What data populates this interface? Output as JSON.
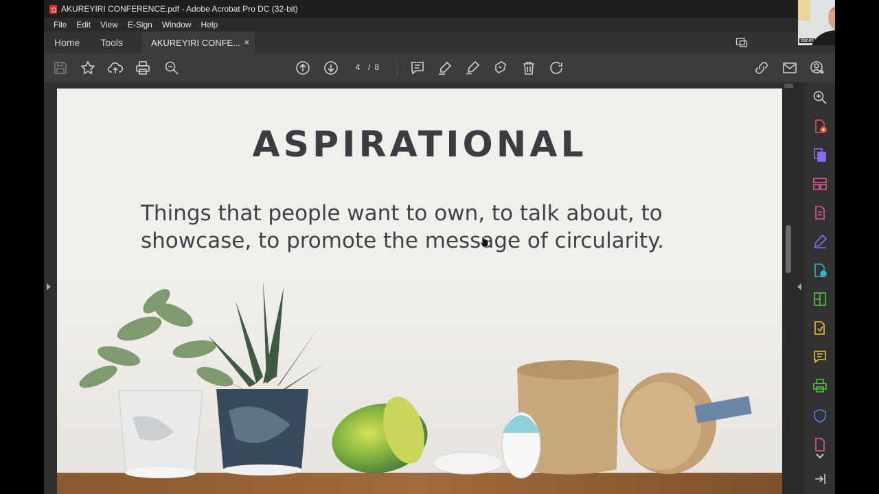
{
  "window": {
    "title": "AKUREYIRI CONFERENCE.pdf - Adobe Acrobat Pro DC (32-bit)"
  },
  "menu": [
    "File",
    "Edit",
    "View",
    "E-Sign",
    "Window",
    "Help"
  ],
  "tabs": {
    "home": "Home",
    "tools": "Tools",
    "document": "AKUREYIRI CONFE...",
    "close": "×"
  },
  "pager": {
    "current": "4",
    "separator": "/",
    "total": "8"
  },
  "page": {
    "heading": "ASPIRATIONAL",
    "body": "Things that people want to own, to talk about, to showcase, to promote the message of circularity."
  },
  "webcam": {
    "name": "daniel"
  },
  "colors": {
    "accent_blue": "#3d8ef0",
    "tool_red": "#e8504a",
    "tool_purple": "#8a6cf0",
    "tool_pink": "#e3559f",
    "tool_green": "#5bbf4a",
    "tool_yellow": "#f2c230",
    "tool_teal": "#2fb6c8",
    "tool_blue": "#4d7cf0"
  },
  "icons": {
    "toolbar": [
      "save-icon",
      "star-icon",
      "upload-icon",
      "print-icon",
      "zoom-out-icon",
      "page-up-icon",
      "page-down-icon",
      "comment-icon",
      "highlight-icon",
      "sign-icon",
      "stamp-icon",
      "delete-icon",
      "rotate-icon",
      "share-link-icon",
      "email-icon",
      "add-user-icon"
    ],
    "tools_pane": [
      "zoom-icon",
      "create-pdf-icon",
      "export-pdf-icon",
      "organize-pages-icon",
      "edit-pdf-icon",
      "fill-sign-icon",
      "combine-files-icon",
      "scan-icon",
      "send-review-icon",
      "comment-tool-icon",
      "print-production-icon",
      "protect-icon",
      "more-tools-icon"
    ]
  }
}
